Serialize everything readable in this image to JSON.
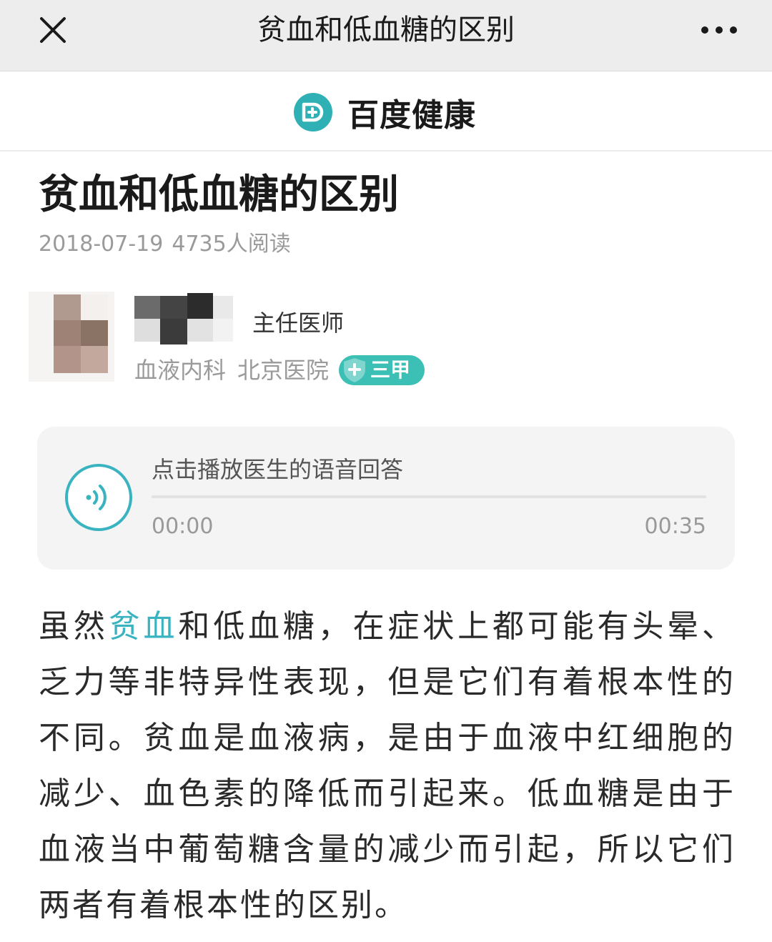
{
  "topbar": {
    "title": "贫血和低血糖的区别",
    "close_icon": "close-icon",
    "more_icon": "more-dots-icon"
  },
  "brand": {
    "name": "百度健康",
    "logo_icon": "baidu-health-logo",
    "color": "#3ab3c1"
  },
  "article": {
    "title": "贫血和低血糖的区别",
    "date": "2018-07-19",
    "reads": "4735人阅读"
  },
  "doctor": {
    "title": "主任医师",
    "department": "血液内科",
    "hospital": "北京医院",
    "grade": "三甲"
  },
  "audio": {
    "prompt": "点击播放医生的语音回答",
    "current_time": "00:00",
    "total_time": "00:35",
    "progress": 0,
    "play_icon": "sound-wave-icon"
  },
  "body": {
    "keyword": "贫血",
    "lead": "虽然",
    "text": "和低血糖，在症状上都可能有头晕、乏力等非特异性表现，但是它们有着根本性的不同。贫血是血液病，是由于血液中红细胞的减少、血色素的降低而引起来。低血糖是由于血液当中葡萄糖含量的减少而引起，所以它们两者有着根本性的区别。"
  },
  "colors": {
    "accent": "#3ab3c1",
    "badge": "#3cbfb5",
    "topbar_bg": "#ededed"
  }
}
